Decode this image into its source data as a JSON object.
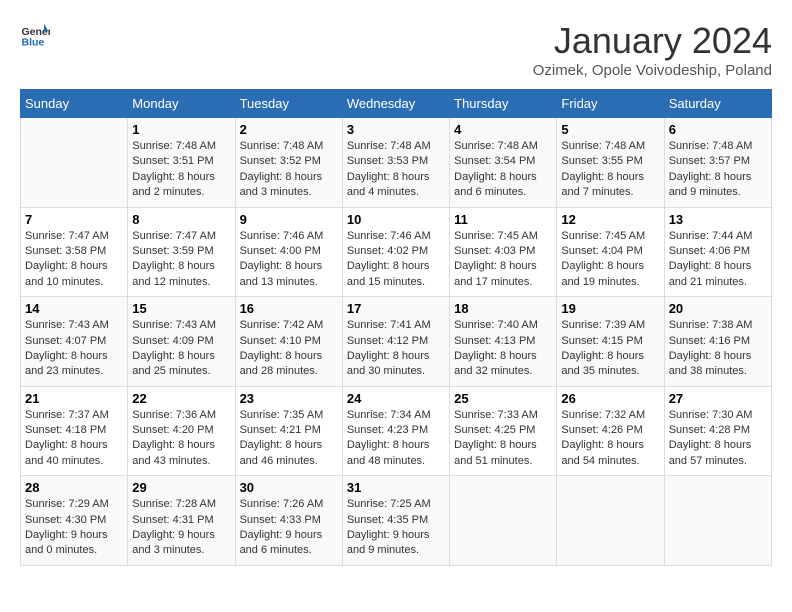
{
  "header": {
    "logo_general": "General",
    "logo_blue": "Blue",
    "title": "January 2024",
    "subtitle": "Ozimek, Opole Voivodeship, Poland"
  },
  "weekdays": [
    "Sunday",
    "Monday",
    "Tuesday",
    "Wednesday",
    "Thursday",
    "Friday",
    "Saturday"
  ],
  "weeks": [
    [
      {
        "day": "",
        "info": ""
      },
      {
        "day": "1",
        "info": "Sunrise: 7:48 AM\nSunset: 3:51 PM\nDaylight: 8 hours\nand 2 minutes."
      },
      {
        "day": "2",
        "info": "Sunrise: 7:48 AM\nSunset: 3:52 PM\nDaylight: 8 hours\nand 3 minutes."
      },
      {
        "day": "3",
        "info": "Sunrise: 7:48 AM\nSunset: 3:53 PM\nDaylight: 8 hours\nand 4 minutes."
      },
      {
        "day": "4",
        "info": "Sunrise: 7:48 AM\nSunset: 3:54 PM\nDaylight: 8 hours\nand 6 minutes."
      },
      {
        "day": "5",
        "info": "Sunrise: 7:48 AM\nSunset: 3:55 PM\nDaylight: 8 hours\nand 7 minutes."
      },
      {
        "day": "6",
        "info": "Sunrise: 7:48 AM\nSunset: 3:57 PM\nDaylight: 8 hours\nand 9 minutes."
      }
    ],
    [
      {
        "day": "7",
        "info": "Sunrise: 7:47 AM\nSunset: 3:58 PM\nDaylight: 8 hours\nand 10 minutes."
      },
      {
        "day": "8",
        "info": "Sunrise: 7:47 AM\nSunset: 3:59 PM\nDaylight: 8 hours\nand 12 minutes."
      },
      {
        "day": "9",
        "info": "Sunrise: 7:46 AM\nSunset: 4:00 PM\nDaylight: 8 hours\nand 13 minutes."
      },
      {
        "day": "10",
        "info": "Sunrise: 7:46 AM\nSunset: 4:02 PM\nDaylight: 8 hours\nand 15 minutes."
      },
      {
        "day": "11",
        "info": "Sunrise: 7:45 AM\nSunset: 4:03 PM\nDaylight: 8 hours\nand 17 minutes."
      },
      {
        "day": "12",
        "info": "Sunrise: 7:45 AM\nSunset: 4:04 PM\nDaylight: 8 hours\nand 19 minutes."
      },
      {
        "day": "13",
        "info": "Sunrise: 7:44 AM\nSunset: 4:06 PM\nDaylight: 8 hours\nand 21 minutes."
      }
    ],
    [
      {
        "day": "14",
        "info": "Sunrise: 7:43 AM\nSunset: 4:07 PM\nDaylight: 8 hours\nand 23 minutes."
      },
      {
        "day": "15",
        "info": "Sunrise: 7:43 AM\nSunset: 4:09 PM\nDaylight: 8 hours\nand 25 minutes."
      },
      {
        "day": "16",
        "info": "Sunrise: 7:42 AM\nSunset: 4:10 PM\nDaylight: 8 hours\nand 28 minutes."
      },
      {
        "day": "17",
        "info": "Sunrise: 7:41 AM\nSunset: 4:12 PM\nDaylight: 8 hours\nand 30 minutes."
      },
      {
        "day": "18",
        "info": "Sunrise: 7:40 AM\nSunset: 4:13 PM\nDaylight: 8 hours\nand 32 minutes."
      },
      {
        "day": "19",
        "info": "Sunrise: 7:39 AM\nSunset: 4:15 PM\nDaylight: 8 hours\nand 35 minutes."
      },
      {
        "day": "20",
        "info": "Sunrise: 7:38 AM\nSunset: 4:16 PM\nDaylight: 8 hours\nand 38 minutes."
      }
    ],
    [
      {
        "day": "21",
        "info": "Sunrise: 7:37 AM\nSunset: 4:18 PM\nDaylight: 8 hours\nand 40 minutes."
      },
      {
        "day": "22",
        "info": "Sunrise: 7:36 AM\nSunset: 4:20 PM\nDaylight: 8 hours\nand 43 minutes."
      },
      {
        "day": "23",
        "info": "Sunrise: 7:35 AM\nSunset: 4:21 PM\nDaylight: 8 hours\nand 46 minutes."
      },
      {
        "day": "24",
        "info": "Sunrise: 7:34 AM\nSunset: 4:23 PM\nDaylight: 8 hours\nand 48 minutes."
      },
      {
        "day": "25",
        "info": "Sunrise: 7:33 AM\nSunset: 4:25 PM\nDaylight: 8 hours\nand 51 minutes."
      },
      {
        "day": "26",
        "info": "Sunrise: 7:32 AM\nSunset: 4:26 PM\nDaylight: 8 hours\nand 54 minutes."
      },
      {
        "day": "27",
        "info": "Sunrise: 7:30 AM\nSunset: 4:28 PM\nDaylight: 8 hours\nand 57 minutes."
      }
    ],
    [
      {
        "day": "28",
        "info": "Sunrise: 7:29 AM\nSunset: 4:30 PM\nDaylight: 9 hours\nand 0 minutes."
      },
      {
        "day": "29",
        "info": "Sunrise: 7:28 AM\nSunset: 4:31 PM\nDaylight: 9 hours\nand 3 minutes."
      },
      {
        "day": "30",
        "info": "Sunrise: 7:26 AM\nSunset: 4:33 PM\nDaylight: 9 hours\nand 6 minutes."
      },
      {
        "day": "31",
        "info": "Sunrise: 7:25 AM\nSunset: 4:35 PM\nDaylight: 9 hours\nand 9 minutes."
      },
      {
        "day": "",
        "info": ""
      },
      {
        "day": "",
        "info": ""
      },
      {
        "day": "",
        "info": ""
      }
    ]
  ]
}
